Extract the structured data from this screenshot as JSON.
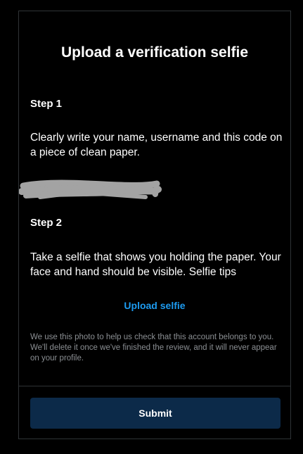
{
  "dialog": {
    "title": "Upload a verification selfie",
    "step1": {
      "heading": "Step 1",
      "text": "Clearly write your name, username and this code on a piece of clean paper."
    },
    "step2": {
      "heading": "Step 2",
      "text": "Take a selfie that shows you holding the paper. Your face and hand should be visible. Selfie tips"
    },
    "upload_label": "Upload selfie",
    "notice": "We use this photo to help us check that this account belongs to you. We'll delete it once we've finished the review, and it will never appear on your profile.",
    "submit_label": "Submit"
  },
  "colors": {
    "background": "#000000",
    "link": "#1d9bf0",
    "submit_bg": "#0c2a49",
    "muted_text": "#8b8f93",
    "redaction": "#a3a3a3"
  }
}
